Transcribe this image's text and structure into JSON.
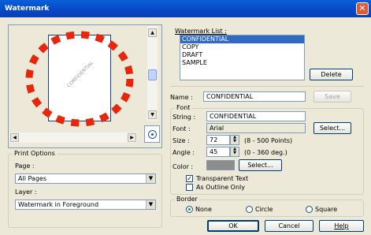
{
  "window": {
    "title": "Watermark",
    "close_glyph": "✕"
  },
  "preview": {
    "watermark_text": "CONFIDENTIAL"
  },
  "print_options": {
    "group_title": "Print Options",
    "page_label": "Page :",
    "page_value": "All Pages",
    "layer_label": "Layer :",
    "layer_value": "Watermark in Foreground"
  },
  "watermark_list": {
    "label": "Watermark List :",
    "items": [
      "CONFIDENTIAL",
      "COPY",
      "DRAFT",
      "SAMPLE"
    ],
    "selected": "CONFIDENTIAL",
    "delete_label": "Delete"
  },
  "name": {
    "label": "Name :",
    "value": "CONFIDENTIAL",
    "save_label": "Save"
  },
  "font": {
    "group_title": "Font",
    "string_label": "String :",
    "string_value": "CONFIDENTIAL",
    "font_label": "Font :",
    "font_value": "Arial",
    "select_label": "Select...",
    "size_label": "Size :",
    "size_value": "72",
    "size_range": "(8 - 500 Points)",
    "angle_label": "Angle :",
    "angle_value": "45",
    "angle_range": "(0 - 360 deg.)",
    "color_label": "Color :",
    "color_select_label": "Select...",
    "color_swatch": "#8c8c8c",
    "transparent_label": "Transparent Text",
    "transparent_checked": true,
    "outline_label": "As Outline Only",
    "outline_checked": false
  },
  "border": {
    "group_title": "Border",
    "options": [
      "None",
      "Circle",
      "Square"
    ],
    "selected": "None"
  },
  "buttons": {
    "ok": "OK",
    "cancel": "Cancel",
    "help": "Help"
  },
  "colors": {
    "accent_red": "#e8260c",
    "selection_blue": "#316ac5"
  }
}
